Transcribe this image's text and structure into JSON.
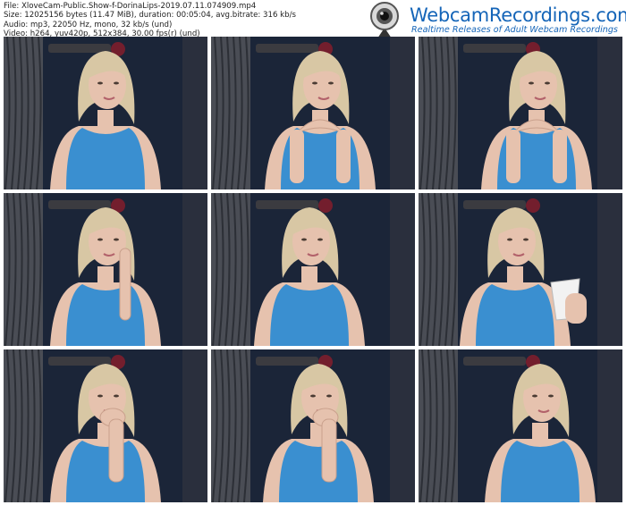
{
  "file_info": {
    "file": "File: XloveCam-Public.Show-f-DorinaLips-2019.07.11.074909.mp4",
    "size": "Size: 12025156 bytes (11.47 MiB), duration: 00:05:04, avg.bitrate: 316 kb/s",
    "audio": "Audio: mp3, 22050 Hz, mono, 32 kb/s (und)",
    "video": "Video: h264, yuv420p, 512x384, 30.00 fps(r) (und)"
  },
  "logo": {
    "title": "WebcamRecordings.com",
    "tagline": "Realtime Releases of Adult Webcam Recordings",
    "icon": "webcam-icon",
    "accent": "#1565b8"
  },
  "thumbnails": [
    {
      "pose": "smiling"
    },
    {
      "pose": "hands-under-chin"
    },
    {
      "pose": "hands-under-chin"
    },
    {
      "pose": "finger-to-face"
    },
    {
      "pose": "neutral"
    },
    {
      "pose": "holding-cup"
    },
    {
      "pose": "hand-to-mouth"
    },
    {
      "pose": "hand-to-mouth"
    },
    {
      "pose": "neutral"
    }
  ],
  "colors": {
    "top_color": "#3a8fd0",
    "hair_color": "#d8c7a4",
    "skin_color": "#e6c2ae",
    "backdrop_color": "#1b2538"
  }
}
